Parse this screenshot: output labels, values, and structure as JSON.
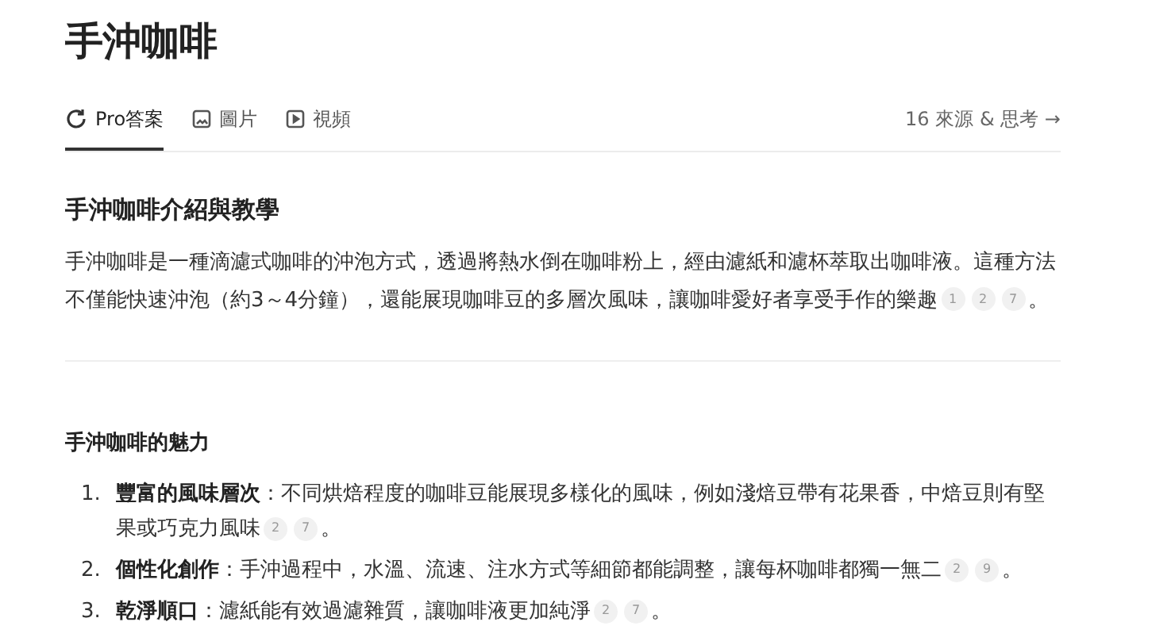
{
  "title": "手沖咖啡",
  "tabs": [
    {
      "label": "Pro答案",
      "kind": "pro",
      "selected": true
    },
    {
      "label": "圖片",
      "kind": "image",
      "selected": false
    },
    {
      "label": "視頻",
      "kind": "video",
      "selected": false
    }
  ],
  "sources_link": "16 來源 & 思考 →",
  "section": {
    "heading": "手沖咖啡介紹與教學",
    "paragraph": {
      "text": "手沖咖啡是一種滴濾式咖啡的沖泡方式，透過將熱水倒在咖啡粉上，經由濾紙和濾杯萃取出咖啡液。這種方法不僅能快速沖泡（約3～4分鐘），還能展現咖啡豆的多層次風味，讓咖啡愛好者享受手作的樂趣",
      "citations": [
        "1",
        "2",
        "7"
      ],
      "end": "。"
    }
  },
  "subsection": {
    "heading": "手沖咖啡的魅力",
    "items": [
      {
        "number": "1.",
        "title": "豐富的風味層次",
        "text": "：不同烘焙程度的咖啡豆能展現多樣化的風味，例如淺焙豆帶有花果香，中焙豆則有堅果或巧克力風味",
        "citations": [
          "2",
          "7"
        ],
        "end": "。"
      },
      {
        "number": "2.",
        "title": "個性化創作",
        "text": "：手沖過程中，水溫、流速、注水方式等細節都能調整，讓每杯咖啡都獨一無二",
        "citations": [
          "2",
          "9"
        ],
        "end": "。"
      },
      {
        "number": "3.",
        "title": "乾淨順口",
        "text": "：濾紙能有效過濾雜質，讓咖啡液更加純淨",
        "citations": [
          "2",
          "7"
        ],
        "end": "。"
      }
    ]
  }
}
